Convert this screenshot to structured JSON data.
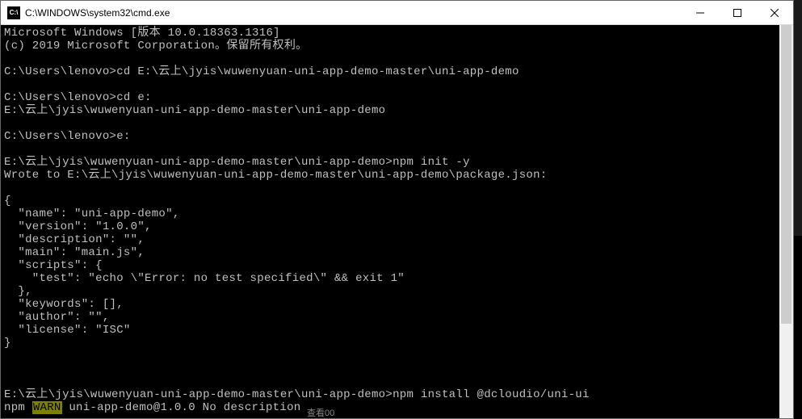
{
  "window": {
    "title": "C:\\WINDOWS\\system32\\cmd.exe",
    "icon_label": "C:\\"
  },
  "terminal": {
    "lines": [
      "Microsoft Windows [版本 10.0.18363.1316]",
      "(c) 2019 Microsoft Corporation。保留所有权利。",
      "",
      "C:\\Users\\lenovo>cd E:\\云上\\jyis\\wuwenyuan-uni-app-demo-master\\uni-app-demo",
      "",
      "C:\\Users\\lenovo>cd e:",
      "E:\\云上\\jyis\\wuwenyuan-uni-app-demo-master\\uni-app-demo",
      "",
      "C:\\Users\\lenovo>e:",
      "",
      "E:\\云上\\jyis\\wuwenyuan-uni-app-demo-master\\uni-app-demo>npm init -y",
      "Wrote to E:\\云上\\jyis\\wuwenyuan-uni-app-demo-master\\uni-app-demo\\package.json:",
      "",
      "{",
      "  \"name\": \"uni-app-demo\",",
      "  \"version\": \"1.0.0\",",
      "  \"description\": \"\",",
      "  \"main\": \"main.js\",",
      "  \"scripts\": {",
      "    \"test\": \"echo \\\"Error: no test specified\\\" && exit 1\"",
      "  },",
      "  \"keywords\": [],",
      "  \"author\": \"\",",
      "  \"license\": \"ISC\"",
      "}",
      "",
      "",
      "",
      "E:\\云上\\jyis\\wuwenyuan-uni-app-demo-master\\uni-app-demo>npm install @dcloudio/uni-ui"
    ],
    "warn_prefix": "npm ",
    "warn_tag": "WARN",
    "warn_rest": " uni-app-demo@1.0.0 No description"
  },
  "footer_hint": "查看00"
}
